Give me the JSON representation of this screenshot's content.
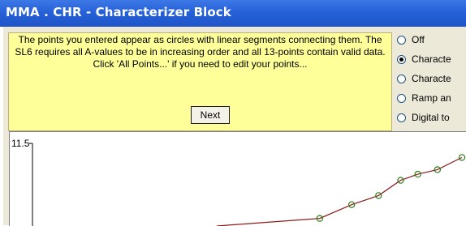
{
  "window": {
    "title": "MMA . CHR - Characterizer Block"
  },
  "help": {
    "message": "The points you entered appear as circles with linear segments connecting them. The SL6 requires all A-values to be in increasing order and all 13-points contain valid data. Click 'All Points...' if you need to edit your points...",
    "next_label": "Next"
  },
  "modes": [
    {
      "label": "Off",
      "selected": false
    },
    {
      "label": "Characte",
      "selected": true
    },
    {
      "label": "Characte",
      "selected": false
    },
    {
      "label": "Ramp an",
      "selected": false
    },
    {
      "label": "Digital to",
      "selected": false
    }
  ],
  "chart_data": {
    "type": "line",
    "y_tick_labels": [
      "11.5"
    ],
    "series_color": "#8b1a1a",
    "marker_color": "#2e7d1a",
    "points_visible": [
      [
        0.0,
        0.0
      ],
      [
        0.42,
        0.1
      ],
      [
        0.55,
        0.28
      ],
      [
        0.66,
        0.4
      ],
      [
        0.75,
        0.6
      ],
      [
        0.82,
        0.68
      ],
      [
        0.9,
        0.74
      ],
      [
        1.0,
        0.9
      ]
    ]
  }
}
